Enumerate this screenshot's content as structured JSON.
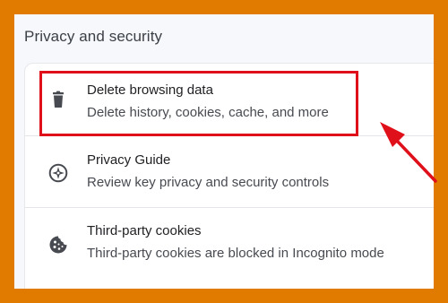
{
  "section": {
    "title": "Privacy and security"
  },
  "items": [
    {
      "icon": "trash-icon",
      "title": "Delete browsing data",
      "subtitle": "Delete history, cookies, cache, and more"
    },
    {
      "icon": "compass-icon",
      "title": "Privacy Guide",
      "subtitle": "Review key privacy and security controls"
    },
    {
      "icon": "cookie-icon",
      "title": "Third-party cookies",
      "subtitle": "Third-party cookies are blocked in Incognito mode"
    }
  ],
  "annotation": {
    "highlight_color": "#e0101b",
    "arrow_color": "#e0101b",
    "frame_color": "#e07b00"
  }
}
